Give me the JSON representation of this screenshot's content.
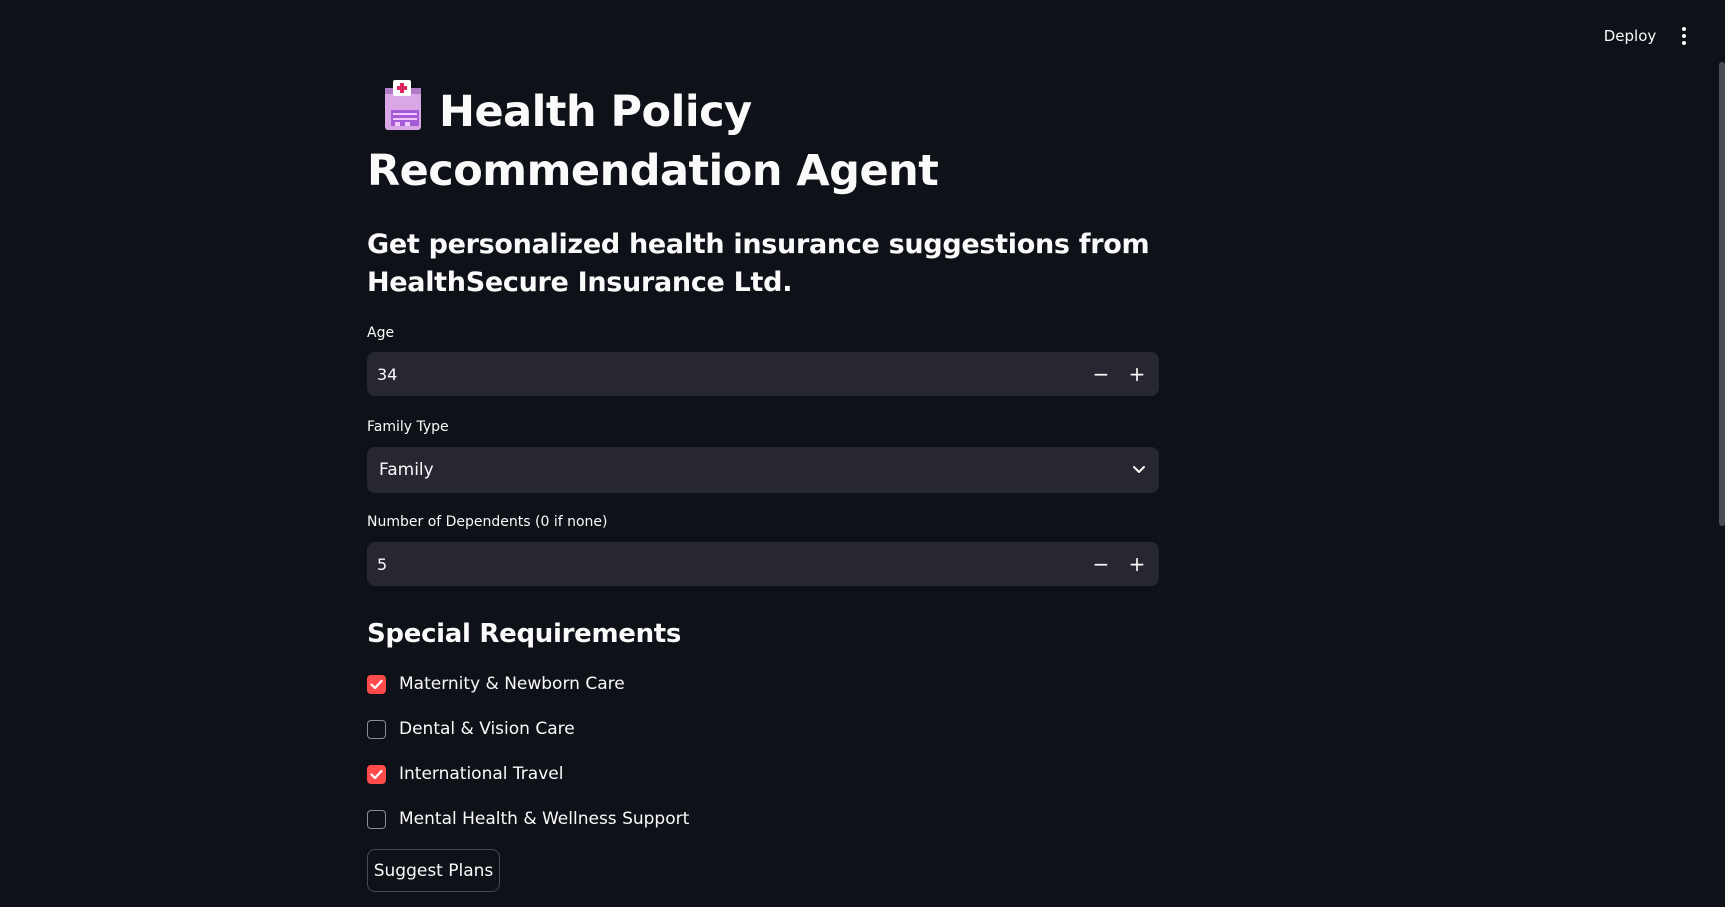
{
  "header": {
    "deploy_label": "Deploy",
    "menu_icon": "kebab-menu-icon"
  },
  "page": {
    "title_icon": "hospital-icon",
    "title": "Health Policy Recommendation Agent",
    "subtitle": "Get personalized health insurance suggestions from HealthSecure Insurance Ltd."
  },
  "form": {
    "age": {
      "label": "Age",
      "value": "34"
    },
    "family_type": {
      "label": "Family Type",
      "selected": "Family"
    },
    "dependents": {
      "label": "Number of Dependents (0 if none)",
      "value": "5"
    }
  },
  "requirements": {
    "title": "Special Requirements",
    "options": [
      {
        "label": "Maternity & Newborn Care",
        "checked": true
      },
      {
        "label": "Dental & Vision Care",
        "checked": false
      },
      {
        "label": "International Travel",
        "checked": true
      },
      {
        "label": "Mental Health & Wellness Support",
        "checked": false
      }
    ]
  },
  "actions": {
    "suggest_label": "Suggest Plans"
  },
  "colors": {
    "background": "#0e1117",
    "input_bg": "#262730",
    "accent": "#ff4b4b",
    "text": "#fafafa"
  }
}
